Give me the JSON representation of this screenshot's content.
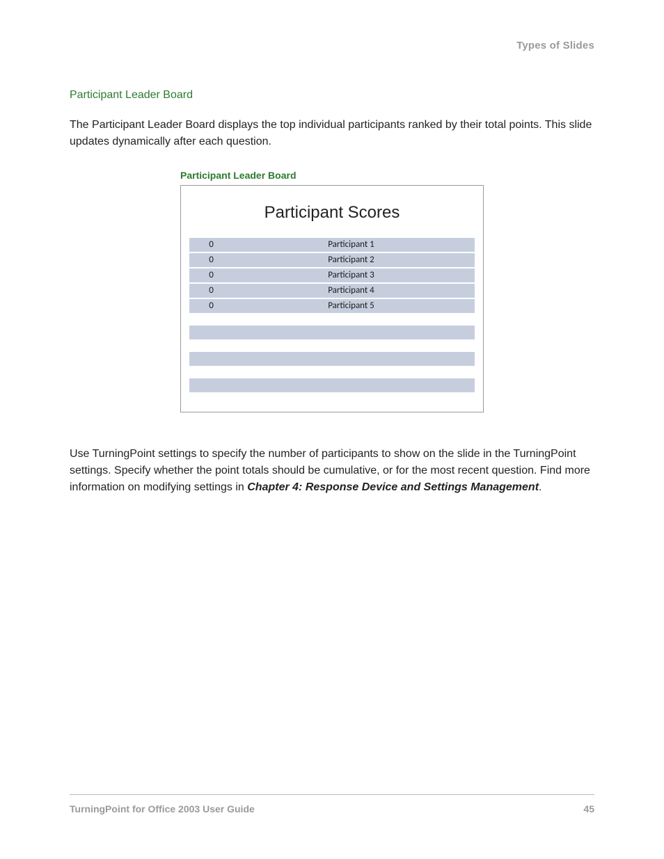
{
  "header": {
    "running": "Types of Slides"
  },
  "section": {
    "heading": "Participant Leader Board",
    "intro": "The Participant Leader Board displays the top individual participants ranked by their total points. This slide updates dynamically after each question."
  },
  "figure": {
    "caption": "Participant Leader Board",
    "title": "Participant Scores",
    "rows": [
      {
        "score": "0",
        "name": "Participant 1"
      },
      {
        "score": "0",
        "name": "Participant 2"
      },
      {
        "score": "0",
        "name": "Participant 3"
      },
      {
        "score": "0",
        "name": "Participant 4"
      },
      {
        "score": "0",
        "name": "Participant 5"
      }
    ]
  },
  "followup": {
    "text_a": "Use TurningPoint settings to specify the number of participants to show on the slide in the TurningPoint settings. Specify whether the point totals should be cumulative, or for the most recent question. Find more information on modifying settings in ",
    "bold": "Chapter 4: Response Device and Settings Management",
    "text_b": "."
  },
  "footer": {
    "left": "TurningPoint for Office 2003 User Guide",
    "right": "45"
  }
}
